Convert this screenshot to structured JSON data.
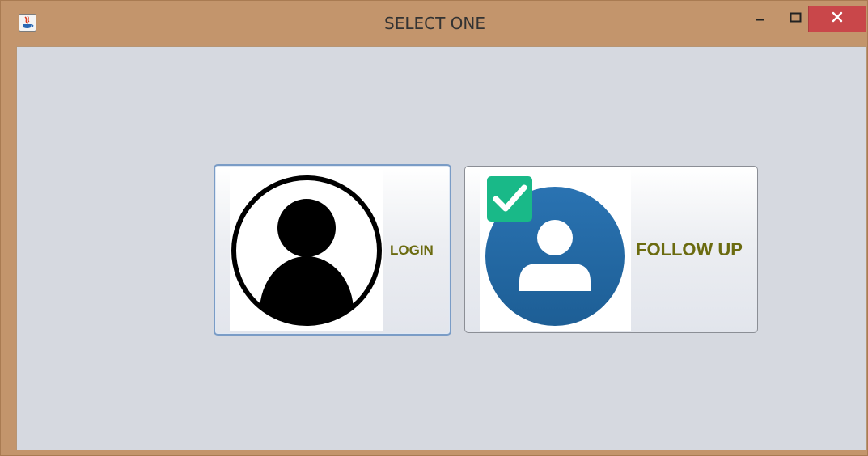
{
  "window": {
    "title": "SELECT ONE",
    "app_icon": "java-icon",
    "controls": {
      "minimize_icon": "minimize-icon",
      "maximize_icon": "maximize-icon",
      "close_icon": "close-icon"
    }
  },
  "buttons": {
    "login": {
      "label": "LOGIN",
      "icon": "user-avatar-icon"
    },
    "follow_up": {
      "label": "FOLLOW UP",
      "icon": "user-check-icon"
    }
  },
  "colors": {
    "title_bar": "#c3956c",
    "client_bg": "#d6d9e0",
    "close_button": "#c9474a",
    "label_text": "#6b6b10",
    "follow_circle": "#2466a1",
    "check_badge": "#19b988"
  }
}
